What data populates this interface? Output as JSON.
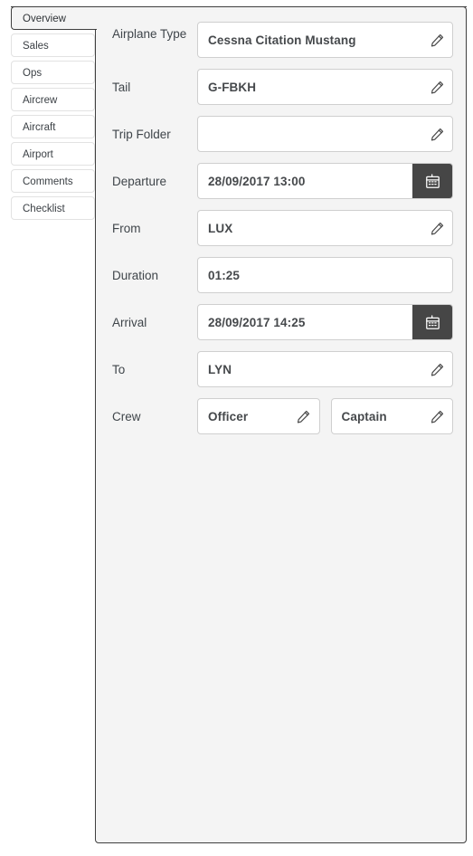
{
  "tabs": [
    {
      "label": "Overview",
      "active": true
    },
    {
      "label": "Sales",
      "active": false
    },
    {
      "label": "Ops",
      "active": false
    },
    {
      "label": "Aircrew",
      "active": false
    },
    {
      "label": "Aircraft",
      "active": false
    },
    {
      "label": "Airport",
      "active": false
    },
    {
      "label": "Comments",
      "active": false
    },
    {
      "label": "Checklist",
      "active": false
    }
  ],
  "form": {
    "airplane_type": {
      "label": "Airplane Type",
      "value": "Cessna Citation Mustang",
      "icon": "pencil-icon"
    },
    "tail": {
      "label": "Tail",
      "value": "G-FBKH",
      "icon": "pencil-icon"
    },
    "trip_folder": {
      "label": "Trip Folder",
      "value": "",
      "placeholder": "",
      "icon": "pencil-icon"
    },
    "departure": {
      "label": "Departure",
      "value": "28/09/2017  13:00",
      "icon": "calendar-icon"
    },
    "from": {
      "label": "From",
      "value": "LUX",
      "icon": "pencil-icon"
    },
    "duration": {
      "label": "Duration",
      "value": "01:25",
      "icon": ""
    },
    "arrival": {
      "label": "Arrival",
      "value": "28/09/2017  14:25",
      "icon": "calendar-icon"
    },
    "to": {
      "label": "To",
      "value": "LYN",
      "icon": "pencil-icon"
    },
    "crew": {
      "label": "Crew",
      "officer": {
        "value": "Officer",
        "icon": "pencil-icon"
      },
      "captain": {
        "value": "Captain",
        "icon": "pencil-icon"
      }
    }
  },
  "colors": {
    "panel_background": "#f4f4f4",
    "panel_border": "#3f3f3f",
    "field_background": "#ffffff",
    "field_border": "#cfcfcf",
    "value_text": "#46494c",
    "label_text": "#3f454a",
    "calendar_button": "#464646",
    "tab_border": "#e2e2e2"
  }
}
